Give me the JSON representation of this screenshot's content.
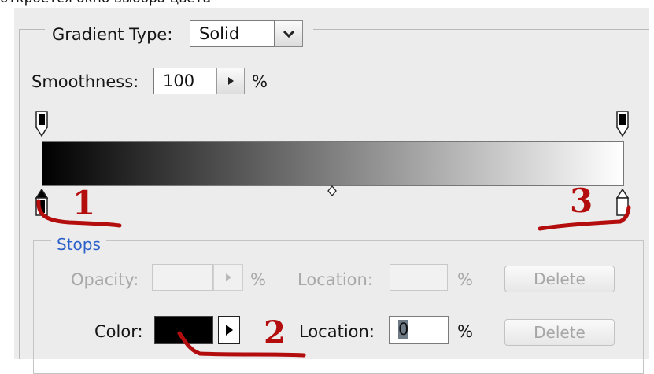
{
  "caption": "откроется окно выбора цвета",
  "gradient_type": {
    "label": "Gradient Type:",
    "value": "Solid"
  },
  "smoothness": {
    "label": "Smoothness:",
    "value": "100",
    "unit": "%"
  },
  "stops": {
    "title": "Stops",
    "opacity": {
      "label": "Opacity:",
      "value": "",
      "unit": "%"
    },
    "opacity_location": {
      "label": "Location:",
      "value": "",
      "unit": "%"
    },
    "color": {
      "label": "Color:",
      "swatch_color": "#000000"
    },
    "color_location": {
      "label": "Location:",
      "value": "0",
      "unit": "%"
    },
    "delete_label_top": "Delete",
    "delete_label_bottom": "Delete"
  },
  "gradient": {
    "start_color": "#000000",
    "end_color": "#ffffff"
  },
  "annotations": {
    "one": "1",
    "two": "2",
    "three": "3",
    "color": "#b30d0d"
  }
}
